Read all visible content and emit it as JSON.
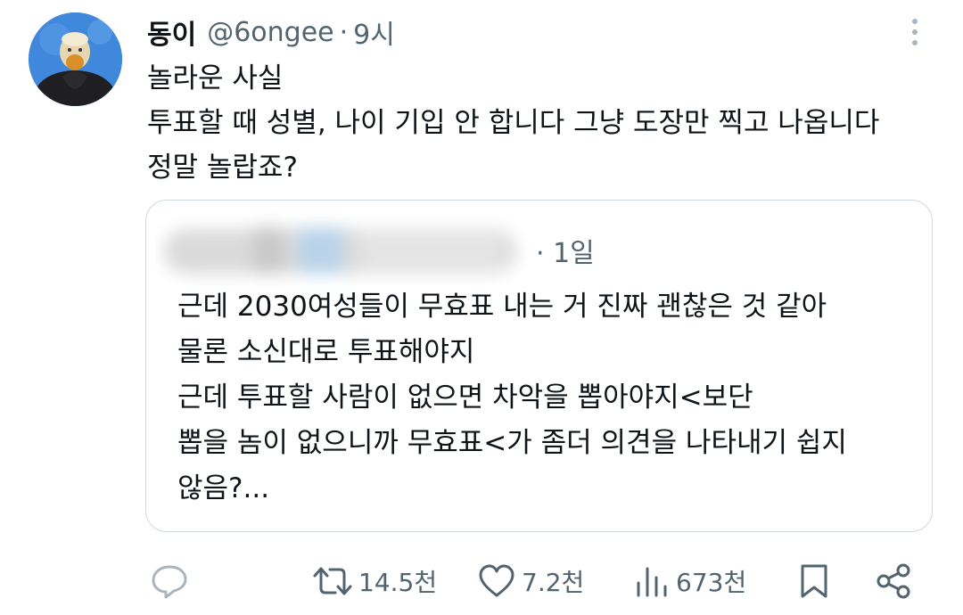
{
  "tweet": {
    "author_name": "동이",
    "author_handle": "@6ongee",
    "separator": "·",
    "time": "9시",
    "lines": [
      "놀라운 사실",
      "투표할 때 성별, 나이 기입 안 합니다 그냥 도장만 찍고 나옵니다",
      "정말 놀랍죠?"
    ]
  },
  "quote": {
    "separator": "·",
    "time": "1일",
    "lines": [
      "근데 2030여성들이 무효표 내는 거 진짜 괜찮은 것 같아",
      "물론 소신대로 투표해야지",
      "근데 투표할 사람이 없으면 차악을 뽑아야지<보단",
      "뽑을 놈이 없으니까 무효표<가 좀더 의견을 나타내기 쉽지",
      "않음?..."
    ]
  },
  "actions": {
    "reply_count": "",
    "retweet_count": "14.5천",
    "like_count": "7.2천",
    "views_count": "673천"
  },
  "icons": {
    "reply": "reply-icon",
    "retweet": "retweet-icon",
    "like": "heart-icon",
    "views": "views-icon",
    "bookmark": "bookmark-icon",
    "share": "share-icon",
    "more": "more-options-icon"
  },
  "colors": {
    "text": "#0f1419",
    "muted": "#536471",
    "border": "#cfd9de",
    "icon": "#536471"
  }
}
